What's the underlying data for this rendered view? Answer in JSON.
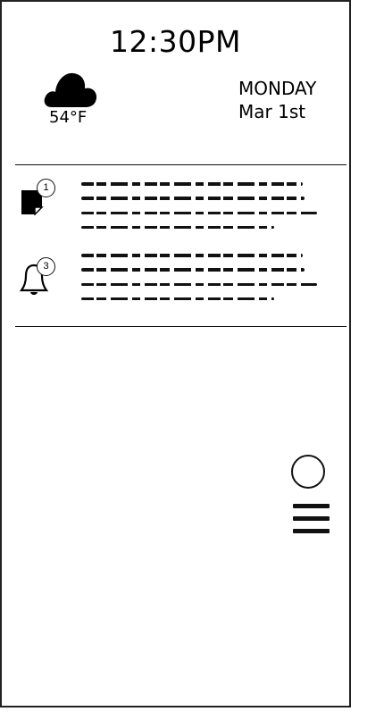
{
  "clock": {
    "time": "12:30PM"
  },
  "weather": {
    "icon": "cloud-icon",
    "temperature": "54°F"
  },
  "date": {
    "day": "MONDAY",
    "date": "Mar 1st"
  },
  "notifications": [
    {
      "icon": "message-icon",
      "count": "1",
      "lines": 4
    },
    {
      "icon": "bell-icon",
      "count": "3",
      "lines": 4
    }
  ],
  "controls": {
    "home": "home-circle-icon",
    "menu": "hamburger-menu-icon"
  }
}
